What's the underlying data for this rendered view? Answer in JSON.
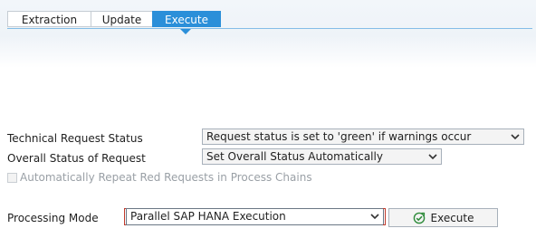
{
  "tabs": [
    {
      "label": "Extraction",
      "active": false
    },
    {
      "label": "Update",
      "active": false
    },
    {
      "label": "Execute",
      "active": true
    }
  ],
  "fields": {
    "technical_status": {
      "label": "Technical Request Status",
      "value": "Request status is set to 'green' if warnings occur"
    },
    "overall_status": {
      "label": "Overall Status of Request",
      "value": "Set Overall Status Automatically"
    },
    "auto_repeat": {
      "label": "Automatically Repeat Red Requests in Process Chains",
      "checked": false,
      "enabled": false
    },
    "processing_mode": {
      "label": "Processing Mode",
      "value": "Parallel SAP HANA Execution"
    }
  },
  "execute_button": {
    "label": "Execute",
    "icon": "execute-icon"
  },
  "colors": {
    "accent": "#2b8fd9",
    "focus": "#c0392b",
    "icon_green": "#2e8b3a"
  }
}
